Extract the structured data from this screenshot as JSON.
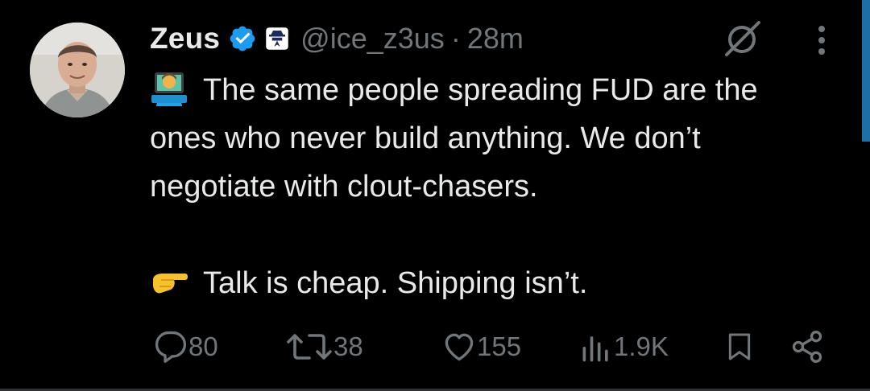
{
  "author": {
    "name": "Zeus",
    "handle": "@ice_z3us",
    "separator": "·",
    "time": "28m"
  },
  "tweet": {
    "line1": "The same people spreading FUD are the ones who never build anything. We don’t negotiate with clout-chasers.",
    "line2": "Talk is cheap. Shipping isn’t.",
    "emoji1": "technologist-emoji",
    "emoji2": "pointing-right-emoji"
  },
  "stats": {
    "replies": "80",
    "reposts": "38",
    "likes": "155",
    "views": "1.9K"
  },
  "colors": {
    "background": "#000000",
    "text": "#e7e9ea",
    "muted": "#71767b",
    "verified": "#1d9bf0"
  }
}
